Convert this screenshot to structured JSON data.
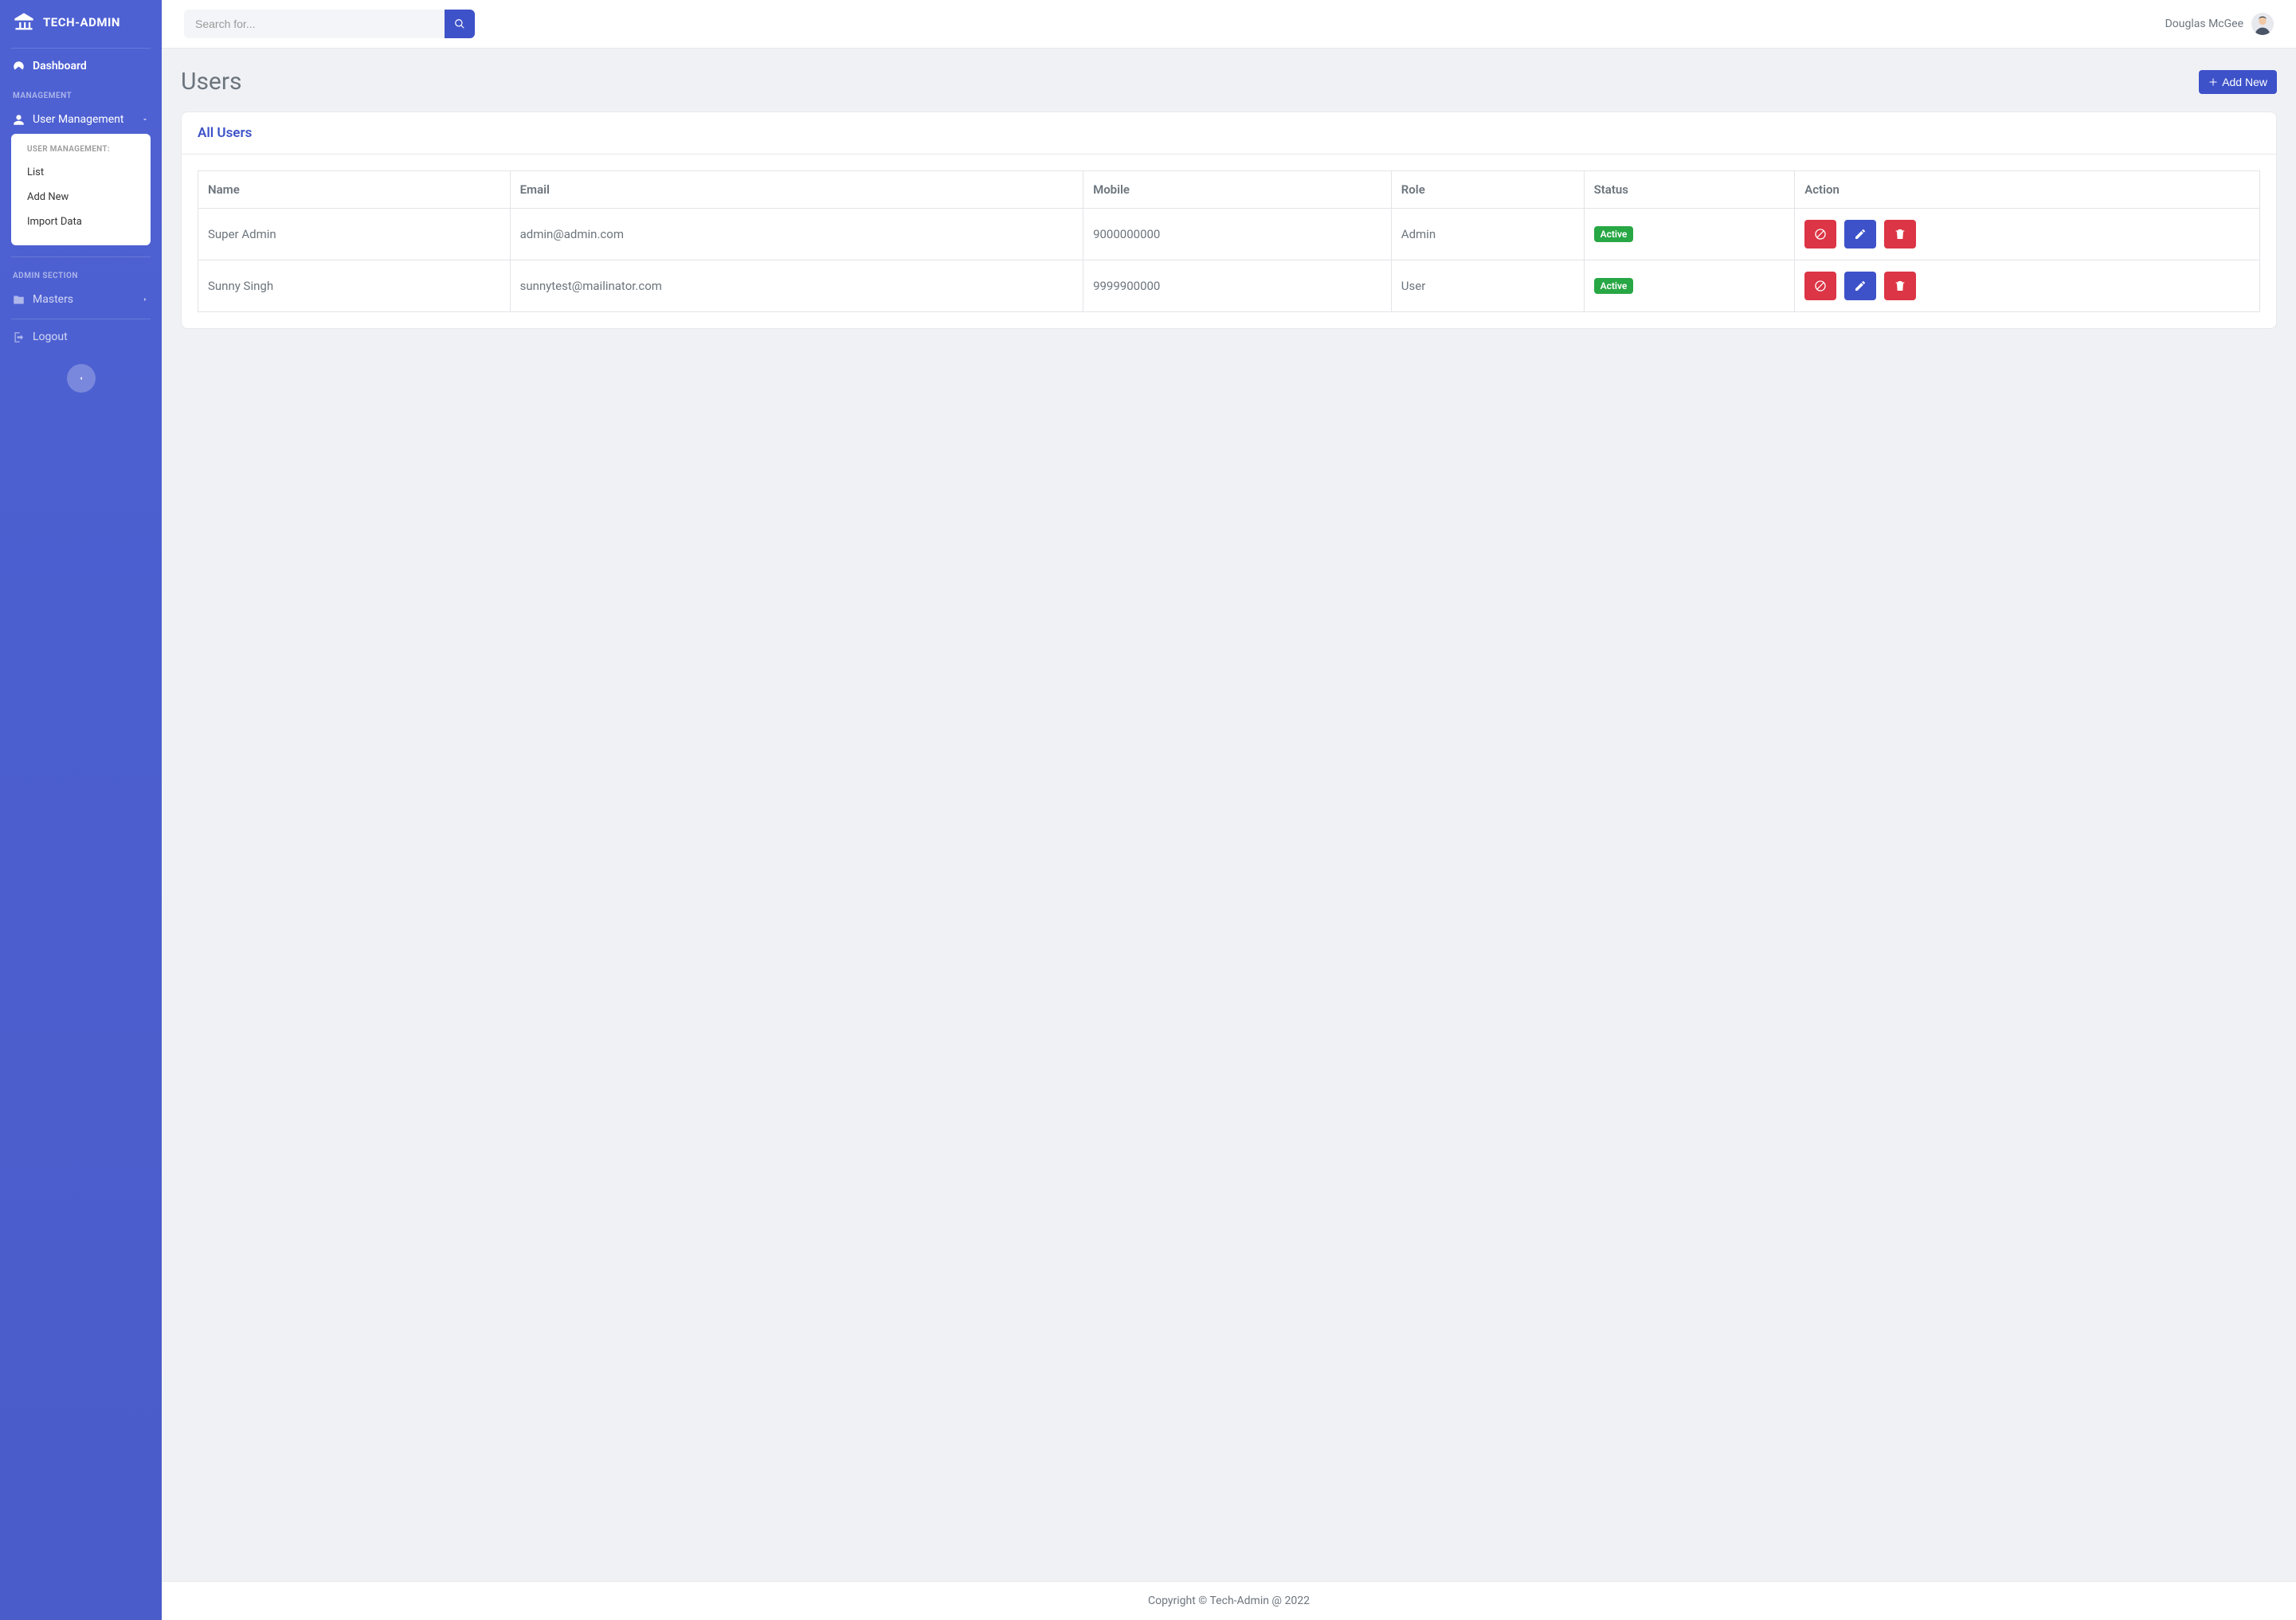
{
  "brand": "TECH-ADMIN",
  "search": {
    "placeholder": "Search for..."
  },
  "user": {
    "name": "Douglas McGee"
  },
  "sidebar": {
    "dashboard_label": "Dashboard",
    "section_management": "MANAGEMENT",
    "user_management_label": "User Management",
    "submenu_heading": "USER MANAGEMENT:",
    "submenu_items": [
      "List",
      "Add New",
      "Import Data"
    ],
    "section_admin": "ADMIN SECTION",
    "masters_label": "Masters",
    "logout_label": "Logout"
  },
  "page": {
    "title": "Users",
    "add_new_label": "Add New",
    "card_title": "All Users"
  },
  "table": {
    "headers": [
      "Name",
      "Email",
      "Mobile",
      "Role",
      "Status",
      "Action"
    ],
    "rows": [
      {
        "name": "Super Admin",
        "email": "admin@admin.com",
        "mobile": "9000000000",
        "role": "Admin",
        "status": "Active"
      },
      {
        "name": "Sunny Singh",
        "email": "sunnytest@mailinator.com",
        "mobile": "9999900000",
        "role": "User",
        "status": "Active"
      }
    ]
  },
  "footer": "Copyright © Tech-Admin @ 2022"
}
